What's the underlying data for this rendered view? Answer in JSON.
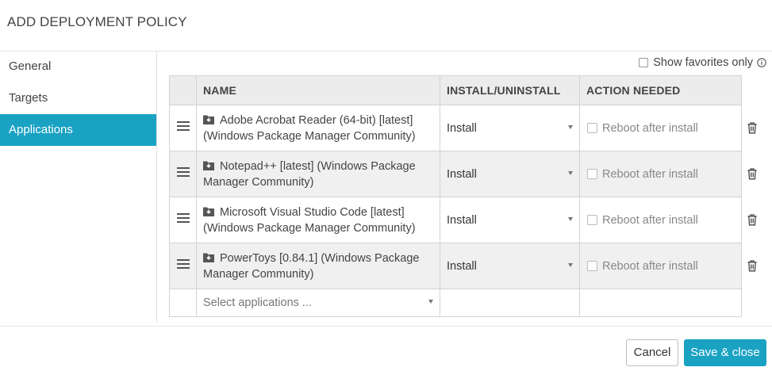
{
  "dialog": {
    "title": "ADD DEPLOYMENT POLICY"
  },
  "sidebar": {
    "items": [
      {
        "label": "General",
        "active": false
      },
      {
        "label": "Targets",
        "active": false
      },
      {
        "label": "Applications",
        "active": true
      }
    ]
  },
  "favorites": {
    "label": "Show favorites only",
    "checked": false
  },
  "table": {
    "headers": {
      "name": "NAME",
      "install": "INSTALL/UNINSTALL",
      "action": "ACTION NEEDED"
    },
    "rows": [
      {
        "name": "Adobe Acrobat Reader (64-bit) [latest] (Windows Package Manager Community)",
        "mode": "Install",
        "action_label": "Reboot after install",
        "action_checked": false
      },
      {
        "name": "Notepad++ [latest] (Windows Package Manager Community)",
        "mode": "Install",
        "action_label": "Reboot after install",
        "action_checked": false
      },
      {
        "name": "Microsoft Visual Studio Code [latest] (Windows Package Manager Community)",
        "mode": "Install",
        "action_label": "Reboot after install",
        "action_checked": false
      },
      {
        "name": "PowerToys [0.84.1] (Windows Package Manager Community)",
        "mode": "Install",
        "action_label": "Reboot after install",
        "action_checked": false
      }
    ],
    "add_placeholder": "Select applications ..."
  },
  "footer": {
    "cancel_label": "Cancel",
    "save_label": "Save & close"
  },
  "colors": {
    "accent": "#1aa2c3",
    "header_bg": "#ececec",
    "alt_row_bg": "#f0f0f0"
  },
  "icons": {
    "row_handle": "drag-handle-icon",
    "package": "download-package-icon",
    "delete": "trash-icon",
    "info": "info-icon",
    "dropdown": "caret-down-icon"
  }
}
